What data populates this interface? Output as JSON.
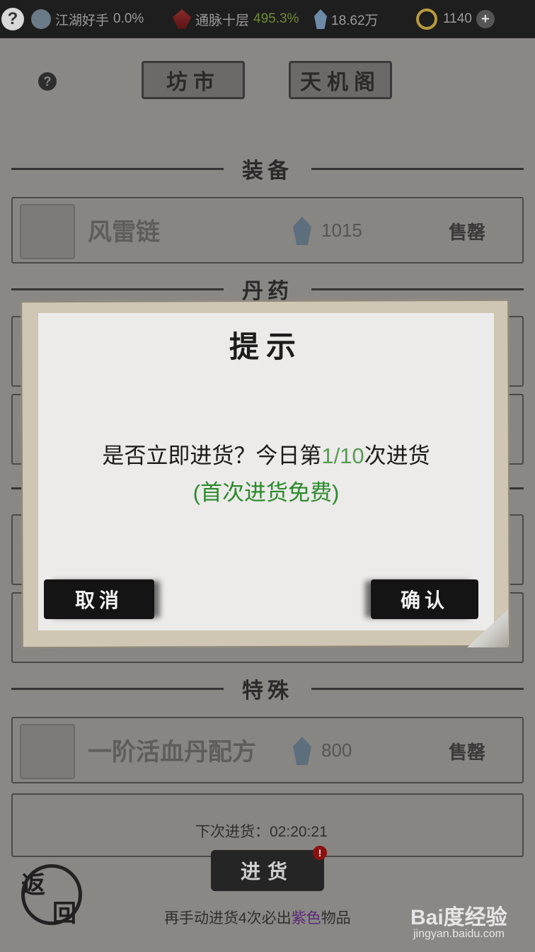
{
  "topbar": {
    "help": "?",
    "rank_title": "江湖好手",
    "rank_progress": "0.0%",
    "realm": "通脉十层",
    "realm_progress": "495.3%",
    "spirit_stones": "18.62万",
    "gold": "1140",
    "plus": "+",
    "colors": {
      "realm_progress": "#7d9a3a"
    }
  },
  "tabs": [
    {
      "label": "坊市"
    },
    {
      "label": "天机阁"
    }
  ],
  "help_button": "?",
  "sections": {
    "equipment": "装备",
    "pills": "丹药",
    "special": "特殊"
  },
  "items": [
    {
      "name": "风雷链",
      "price": "1015",
      "status": "售罄"
    },
    {
      "name": "一阶活血丹配方",
      "price": "800",
      "status": "售罄"
    }
  ],
  "footer": {
    "next_restock_label": "下次进货：",
    "next_restock_time": "02:20:21",
    "restock_button": "进货",
    "badge": "!",
    "hint_prefix": "再手动进货4次必出",
    "hint_highlight": "紫色",
    "hint_suffix": "物品",
    "back": [
      "返",
      "回"
    ]
  },
  "dialog": {
    "title": "提示",
    "message_prefix": "是否立即进货？今日第",
    "message_count": "1/10",
    "message_suffix": "次进货",
    "sub": "(首次进货免费)",
    "cancel": "取消",
    "confirm": "确认"
  },
  "watermark": {
    "brand": "Bai度经验",
    "url": "jingyan.baidu.com"
  }
}
